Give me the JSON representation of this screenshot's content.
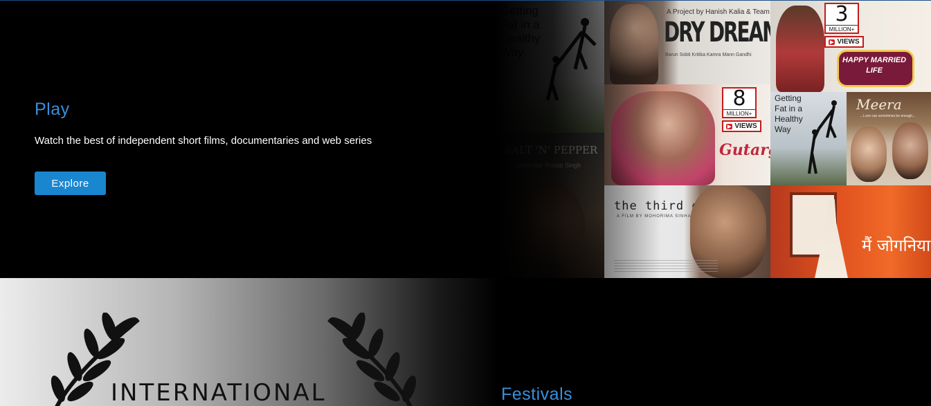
{
  "play": {
    "title": "Play",
    "description": "Watch the best of independent short films, documentaries and web series",
    "explore_label": "Explore"
  },
  "collage": {
    "fat_title": "Getting Fat in a Healthy Way",
    "salt_pepper_title": "SALT 'N' PEPPER",
    "salt_pepper_credit": "Mohinder Pratap Singh",
    "dry_dreams": {
      "credit_top": "A Project by Hanish Kalia & Team",
      "title": "DRY DREAMS",
      "cast": "Barun Sobti Kritika Kamra Mann Gandhi"
    },
    "happy_married": {
      "views_number": "3",
      "views_million": "MILLION+",
      "views_label": "VIEWS",
      "title": "HAPPY MARRIED LIFE"
    },
    "gutargu": {
      "views_number": "8",
      "views_million": "MILLION+",
      "views_label": "VIEWS",
      "title": "Gutargu"
    },
    "meera": {
      "title": "Meera",
      "tagline": "...Love can sometimes be enough..."
    },
    "third_eye": {
      "title": "the third eye",
      "credit": "A FILM BY MOHORIMA SINHA"
    },
    "jogniya": {
      "title": "मैं जोगनिया"
    }
  },
  "festivals": {
    "title": "Festivals",
    "image_word": "INTERNATIONAL"
  }
}
